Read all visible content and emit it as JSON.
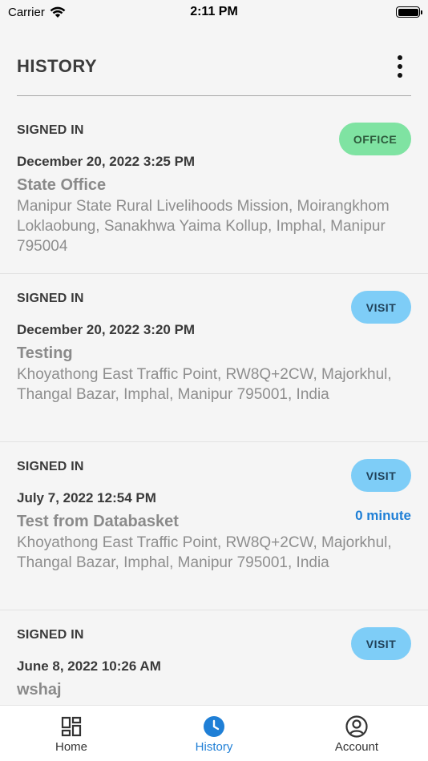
{
  "status_bar": {
    "carrier": "Carrier",
    "time": "2:11 PM"
  },
  "header": {
    "title": "HISTORY"
  },
  "entries": [
    {
      "status": "SIGNED IN",
      "badge": "OFFICE",
      "date": "December 20, 2022 3:25 PM",
      "place": "State Office",
      "address": "Manipur State Rural Livelihoods Mission, Moirangkhom Loklaobung, Sanakhwa Yaima Kollup, Imphal, Manipur 795004",
      "duration": ""
    },
    {
      "status": "SIGNED IN",
      "badge": "VISIT",
      "date": "December 20, 2022 3:20 PM",
      "place": "Testing",
      "address": "Khoyathong East Traffic Point, RW8Q+2CW, Majorkhul, Thangal Bazar, Imphal, Manipur 795001, India",
      "duration": ""
    },
    {
      "status": "SIGNED IN",
      "badge": "VISIT",
      "date": "July 7, 2022 12:54 PM",
      "place": "Test from Databasket",
      "address": "Khoyathong East Traffic Point, RW8Q+2CW, Majorkhul, Thangal Bazar, Imphal, Manipur 795001, India",
      "duration": "0 minute"
    },
    {
      "status": "SIGNED IN",
      "badge": "VISIT",
      "date": "June 8, 2022 10:26 AM",
      "place": "wshaj",
      "address": "",
      "duration": ""
    }
  ],
  "tabs": [
    {
      "label": "Home",
      "icon": "grid-icon",
      "active": false
    },
    {
      "label": "History",
      "icon": "clock-icon",
      "active": true
    },
    {
      "label": "Account",
      "icon": "user-circle-icon",
      "active": false
    }
  ],
  "colors": {
    "office_badge": "#7fe3a2",
    "visit_badge": "#7ecdf7",
    "accent": "#1f7fd6",
    "background": "#f5f5f5"
  }
}
